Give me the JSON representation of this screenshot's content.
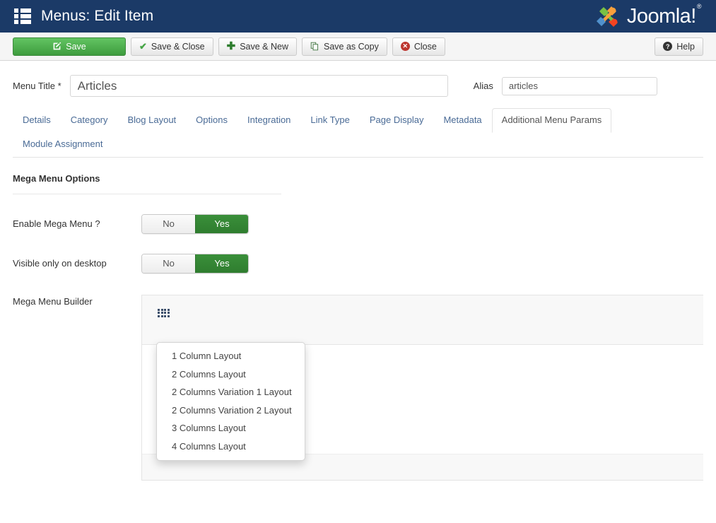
{
  "header": {
    "title": "Menus: Edit Item",
    "menu_icon": "hamburger-grid-icon",
    "logo_text": "Joomla!",
    "logo_reg": "®",
    "bar_color": "#1b3a67"
  },
  "toolbar": {
    "buttons": [
      {
        "label": "Save",
        "icon": "pencil-square-icon",
        "style": "primary-green"
      },
      {
        "label": "Save & Close",
        "icon": "check-icon",
        "style": "default"
      },
      {
        "label": "Save & New",
        "icon": "plus-icon",
        "style": "default"
      },
      {
        "label": "Save as Copy",
        "icon": "copy-icon",
        "style": "default"
      },
      {
        "label": "Close",
        "icon": "close-circle-icon",
        "style": "default"
      }
    ],
    "help": {
      "label": "Help",
      "icon": "help-circle-icon"
    },
    "save_color": "#3e9c3e"
  },
  "form": {
    "menu_title_label": "Menu Title *",
    "menu_title_value": "Articles",
    "menu_title_placeholder": "",
    "alias_label": "Alias",
    "alias_value": "articles",
    "alias_placeholder": ""
  },
  "tabs": {
    "row1": [
      {
        "label": "Details",
        "active": false
      },
      {
        "label": "Category",
        "active": false
      },
      {
        "label": "Blog Layout",
        "active": false
      },
      {
        "label": "Options",
        "active": false
      },
      {
        "label": "Integration",
        "active": false
      },
      {
        "label": "Link Type",
        "active": false
      },
      {
        "label": "Page Display",
        "active": false
      },
      {
        "label": "Metadata",
        "active": false
      },
      {
        "label": "Additional Menu Params",
        "active": true
      }
    ],
    "row2": [
      {
        "label": "Module Assignment",
        "active": false
      }
    ]
  },
  "section": {
    "heading": "Mega Menu Options"
  },
  "controls": [
    {
      "label": "Enable Mega Menu ?",
      "off_label": "No",
      "on_label": "Yes",
      "value": "Yes"
    },
    {
      "label": "Visible only on desktop",
      "off_label": "No",
      "on_label": "Yes",
      "value": "Yes"
    }
  ],
  "builder": {
    "label": "Mega Menu Builder",
    "grid_icon": "grid-dots-icon"
  },
  "dropdown": {
    "items": [
      {
        "label": "1 Column Layout"
      },
      {
        "label": "2 Columns Layout"
      },
      {
        "label": "2 Columns Variation 1 Layout"
      },
      {
        "label": "2 Columns Variation 2 Layout"
      },
      {
        "label": "3 Columns Layout"
      },
      {
        "label": "4 Columns Layout"
      }
    ]
  }
}
